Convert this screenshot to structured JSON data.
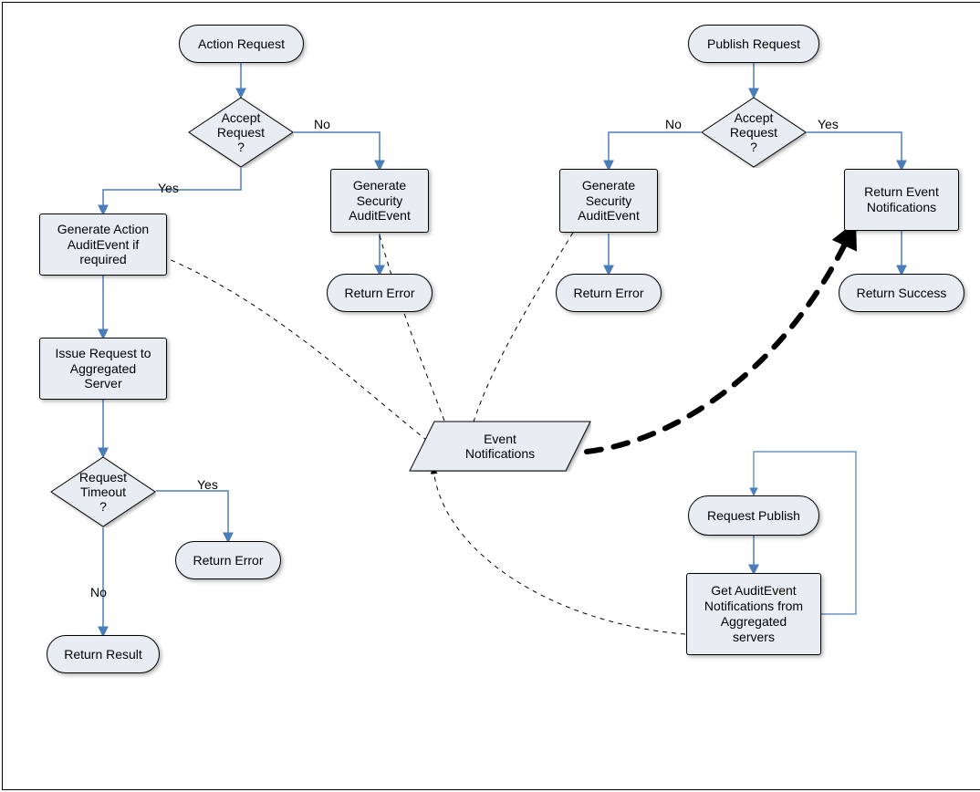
{
  "nodes": {
    "actionRequest": "Action Request",
    "acceptRequest1": "Accept\nRequest\n?",
    "genActionAudit": "Generate Action\nAuditEvent if\nrequired",
    "genSecAudit1": "Generate\nSecurity\nAuditEvent",
    "returnErrorA": "Return Error",
    "issueRequest": "Issue Request to\nAggregated\nServer",
    "requestTimeout": "Request\nTimeout\n?",
    "returnErrorB": "Return Error",
    "returnResult": "Return Result",
    "publishRequest": "Publish Request",
    "acceptRequest2": "Accept\nRequest\n?",
    "genSecAudit2": "Generate\nSecurity\nAuditEvent",
    "returnErrorC": "Return Error",
    "returnEventNotif": "Return Event\nNotifications",
    "returnSuccess": "Return Success",
    "eventNotifications": "Event\nNotifications",
    "requestPublish": "Request Publish",
    "getAuditEvent": "Get AuditEvent\nNotifications from\nAggregated\nservers"
  },
  "labels": {
    "yes1": "Yes",
    "no1": "No",
    "no2": "No",
    "timeoutYes": "Yes",
    "yes2": "Yes",
    "noP": "No"
  }
}
